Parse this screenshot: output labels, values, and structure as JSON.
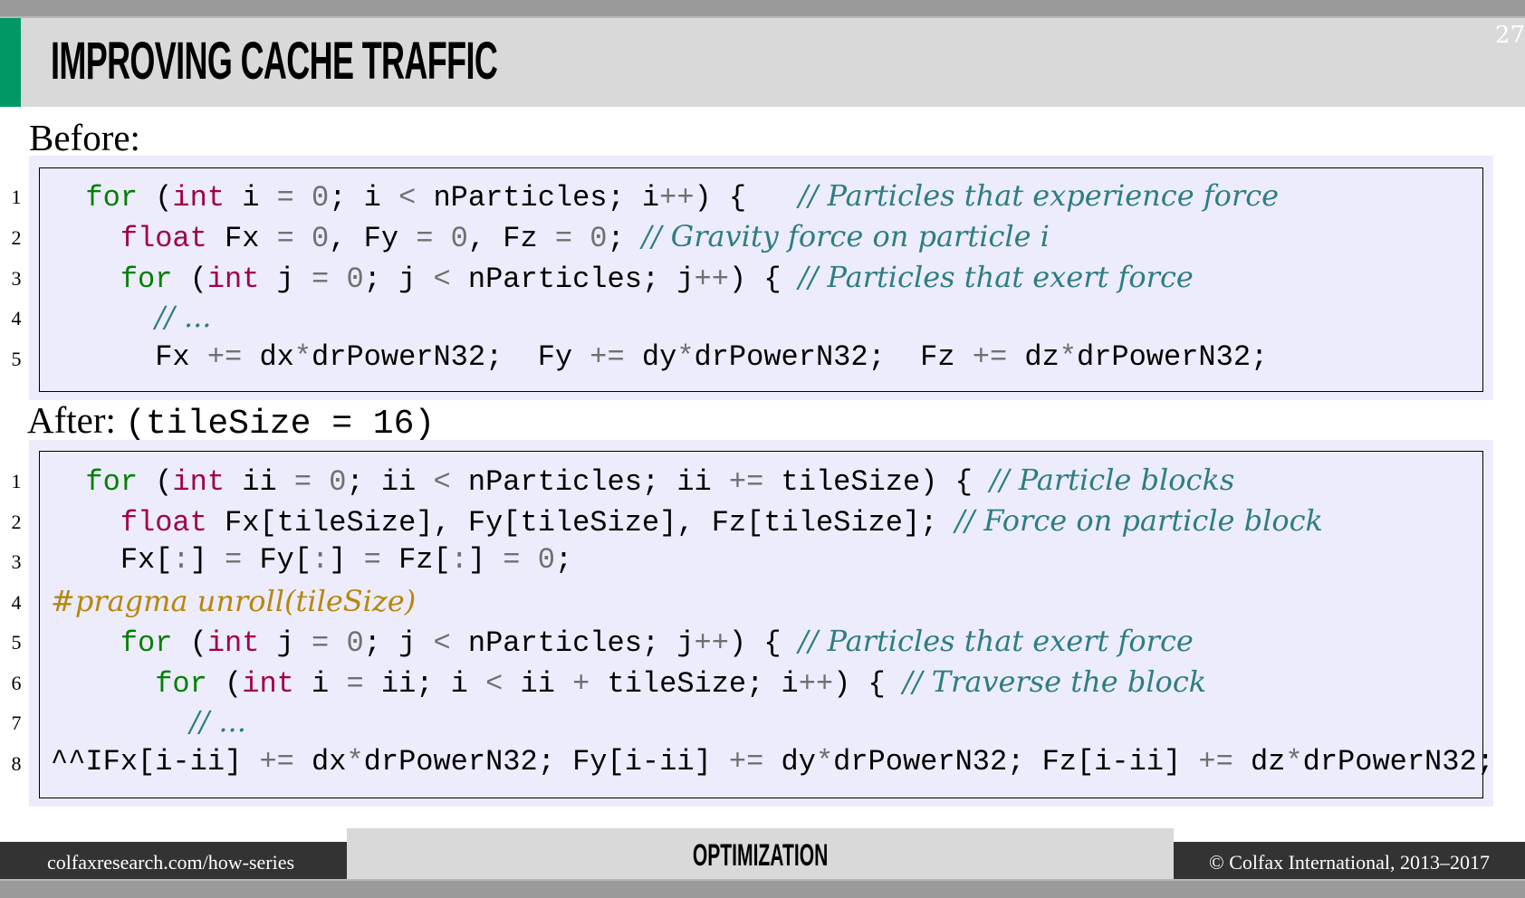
{
  "slide": {
    "title": "IMPROVING CACHE TRAFFIC",
    "page_number": "27",
    "accent_color": "#009966"
  },
  "before": {
    "label": "Before:",
    "lines": [
      {
        "n": "1",
        "tokens": [
          [
            "",
            "  "
          ],
          [
            "kw-green",
            "for"
          ],
          [
            "",
            " ("
          ],
          [
            "kw-red",
            "int"
          ],
          [
            "",
            " i "
          ],
          [
            "op",
            "="
          ],
          [
            "",
            " "
          ],
          [
            "num",
            "0"
          ],
          [
            "",
            "; i "
          ],
          [
            "op",
            "<"
          ],
          [
            "",
            " nParticles; i"
          ],
          [
            "op",
            "++"
          ],
          [
            "",
            ") {   "
          ],
          [
            "cm",
            "// Particles that experience force"
          ]
        ]
      },
      {
        "n": "2",
        "tokens": [
          [
            "",
            "    "
          ],
          [
            "kw-red",
            "float"
          ],
          [
            "",
            " Fx "
          ],
          [
            "op",
            "="
          ],
          [
            "",
            " "
          ],
          [
            "num",
            "0"
          ],
          [
            "",
            ", Fy "
          ],
          [
            "op",
            "="
          ],
          [
            "",
            " "
          ],
          [
            "num",
            "0"
          ],
          [
            "",
            ", Fz "
          ],
          [
            "op",
            "="
          ],
          [
            "",
            " "
          ],
          [
            "num",
            "0"
          ],
          [
            "",
            "; "
          ],
          [
            "cm",
            "// Gravity force on particle i"
          ]
        ]
      },
      {
        "n": "3",
        "tokens": [
          [
            "",
            "    "
          ],
          [
            "kw-green",
            "for"
          ],
          [
            "",
            " ("
          ],
          [
            "kw-red",
            "int"
          ],
          [
            "",
            " j "
          ],
          [
            "op",
            "="
          ],
          [
            "",
            " "
          ],
          [
            "num",
            "0"
          ],
          [
            "",
            "; j "
          ],
          [
            "op",
            "<"
          ],
          [
            "",
            " nParticles; j"
          ],
          [
            "op",
            "++"
          ],
          [
            "",
            ") { "
          ],
          [
            "cm",
            "// Particles that exert force"
          ]
        ]
      },
      {
        "n": "4",
        "tokens": [
          [
            "",
            "      "
          ],
          [
            "cm",
            "// ..."
          ]
        ]
      },
      {
        "n": "5",
        "tokens": [
          [
            "",
            "      Fx "
          ],
          [
            "op",
            "+="
          ],
          [
            "",
            " dx"
          ],
          [
            "op",
            "*"
          ],
          [
            "",
            "drPowerN32;  Fy "
          ],
          [
            "op",
            "+="
          ],
          [
            "",
            " dy"
          ],
          [
            "op",
            "*"
          ],
          [
            "",
            "drPowerN32;  Fz "
          ],
          [
            "op",
            "+="
          ],
          [
            "",
            " dz"
          ],
          [
            "op",
            "*"
          ],
          [
            "",
            "drPowerN32;"
          ]
        ]
      }
    ]
  },
  "after": {
    "label": "After:",
    "label_code": "(tileSize = 16)",
    "lines": [
      {
        "n": "1",
        "tokens": [
          [
            "",
            "  "
          ],
          [
            "kw-green",
            "for"
          ],
          [
            "",
            " ("
          ],
          [
            "kw-red",
            "int"
          ],
          [
            "",
            " ii "
          ],
          [
            "op",
            "="
          ],
          [
            "",
            " "
          ],
          [
            "num",
            "0"
          ],
          [
            "",
            "; ii "
          ],
          [
            "op",
            "<"
          ],
          [
            "",
            " nParticles; ii "
          ],
          [
            "op",
            "+="
          ],
          [
            "",
            " tileSize) { "
          ],
          [
            "cm",
            "// Particle blocks"
          ]
        ]
      },
      {
        "n": "2",
        "tokens": [
          [
            "",
            "    "
          ],
          [
            "kw-red",
            "float"
          ],
          [
            "",
            " Fx[tileSize], Fy[tileSize], Fz[tileSize]; "
          ],
          [
            "cm",
            "// Force on particle block"
          ]
        ]
      },
      {
        "n": "3",
        "tokens": [
          [
            "",
            "    Fx["
          ],
          [
            "op",
            ":"
          ],
          [
            "",
            "] "
          ],
          [
            "op",
            "="
          ],
          [
            "",
            " Fy["
          ],
          [
            "op",
            ":"
          ],
          [
            "",
            "] "
          ],
          [
            "op",
            "="
          ],
          [
            "",
            " Fz["
          ],
          [
            "op",
            ":"
          ],
          [
            "",
            "] "
          ],
          [
            "op",
            "="
          ],
          [
            "",
            " "
          ],
          [
            "num",
            "0"
          ],
          [
            "",
            ";"
          ]
        ]
      },
      {
        "n": "4",
        "tokens": [
          [
            "pp",
            "#pragma unroll(tileSize)"
          ]
        ]
      },
      {
        "n": "5",
        "tokens": [
          [
            "",
            "    "
          ],
          [
            "kw-green",
            "for"
          ],
          [
            "",
            " ("
          ],
          [
            "kw-red",
            "int"
          ],
          [
            "",
            " j "
          ],
          [
            "op",
            "="
          ],
          [
            "",
            " "
          ],
          [
            "num",
            "0"
          ],
          [
            "",
            "; j "
          ],
          [
            "op",
            "<"
          ],
          [
            "",
            " nParticles; j"
          ],
          [
            "op",
            "++"
          ],
          [
            "",
            ") { "
          ],
          [
            "cm",
            "// Particles that exert force"
          ]
        ]
      },
      {
        "n": "6",
        "tokens": [
          [
            "",
            "      "
          ],
          [
            "kw-green",
            "for"
          ],
          [
            "",
            " ("
          ],
          [
            "kw-red",
            "int"
          ],
          [
            "",
            " i "
          ],
          [
            "op",
            "="
          ],
          [
            "",
            " ii; i "
          ],
          [
            "op",
            "<"
          ],
          [
            "",
            " ii "
          ],
          [
            "op",
            "+"
          ],
          [
            "",
            " tileSize; i"
          ],
          [
            "op",
            "++"
          ],
          [
            "",
            ") { "
          ],
          [
            "cm",
            "// Traverse the block"
          ]
        ]
      },
      {
        "n": "7",
        "tokens": [
          [
            "",
            "        "
          ],
          [
            "cm",
            "// ..."
          ]
        ]
      },
      {
        "n": "8",
        "tokens": [
          [
            "",
            "^^IFx[i-ii] "
          ],
          [
            "op",
            "+="
          ],
          [
            "",
            " dx"
          ],
          [
            "op",
            "*"
          ],
          [
            "",
            "drPowerN32; Fy[i-ii] "
          ],
          [
            "op",
            "+="
          ],
          [
            "",
            " dy"
          ],
          [
            "op",
            "*"
          ],
          [
            "",
            "drPowerN32; Fz[i-ii] "
          ],
          [
            "op",
            "+="
          ],
          [
            "",
            " dz"
          ],
          [
            "op",
            "*"
          ],
          [
            "",
            "drPowerN32;"
          ]
        ]
      }
    ]
  },
  "footer": {
    "left": "colfaxresearch.com/how-series",
    "center": "OPTIMIZATION",
    "right": "© Colfax International, 2013–2017"
  }
}
